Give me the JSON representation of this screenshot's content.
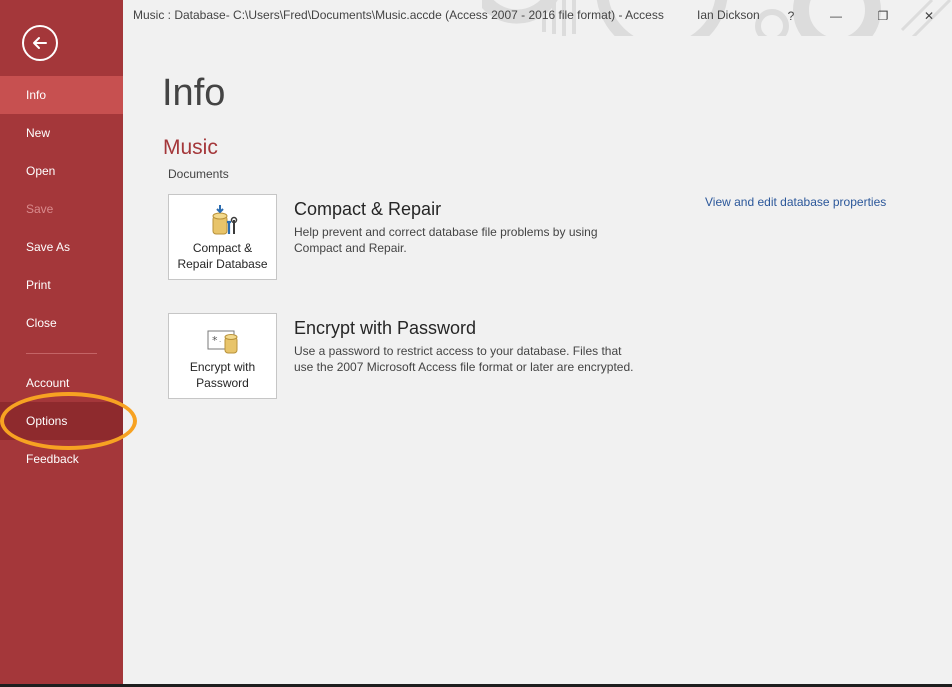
{
  "window": {
    "title": "Music : Database- C:\\Users\\Fred\\Documents\\Music.accde (Access 2007 - 2016 file format) - Access",
    "user": "Ian Dickson",
    "help": "?",
    "minimize": "—",
    "restore": "❐",
    "close": "✕"
  },
  "sidebar": {
    "back_icon": "back-arrow-icon",
    "items": [
      {
        "label": "Info",
        "state": "active"
      },
      {
        "label": "New",
        "state": "normal"
      },
      {
        "label": "Open",
        "state": "normal"
      },
      {
        "label": "Save",
        "state": "disabled"
      },
      {
        "label": "Save As",
        "state": "normal"
      },
      {
        "label": "Print",
        "state": "normal"
      },
      {
        "label": "Close",
        "state": "normal"
      },
      {
        "label": "Account",
        "state": "normal"
      },
      {
        "label": "Options",
        "state": "hover"
      },
      {
        "label": "Feedback",
        "state": "normal"
      }
    ],
    "highlight_color": "#f7a222",
    "accent": "#a4373a"
  },
  "main": {
    "title": "Info",
    "database_name": "Music",
    "database_location": "Documents",
    "properties_link": "View and edit database properties",
    "actions": [
      {
        "tile_label_line1": "Compact &",
        "tile_label_line2": "Repair Database",
        "icon": "compact-repair-icon",
        "heading": "Compact & Repair",
        "description": "Help prevent and correct database file problems by using Compact and Repair."
      },
      {
        "tile_label_line1": "Encrypt with",
        "tile_label_line2": "Password",
        "icon": "encrypt-password-icon",
        "heading": "Encrypt with Password",
        "description": "Use a password to restrict access to your database. Files that use the 2007 Microsoft Access file format or later are encrypted."
      }
    ]
  }
}
